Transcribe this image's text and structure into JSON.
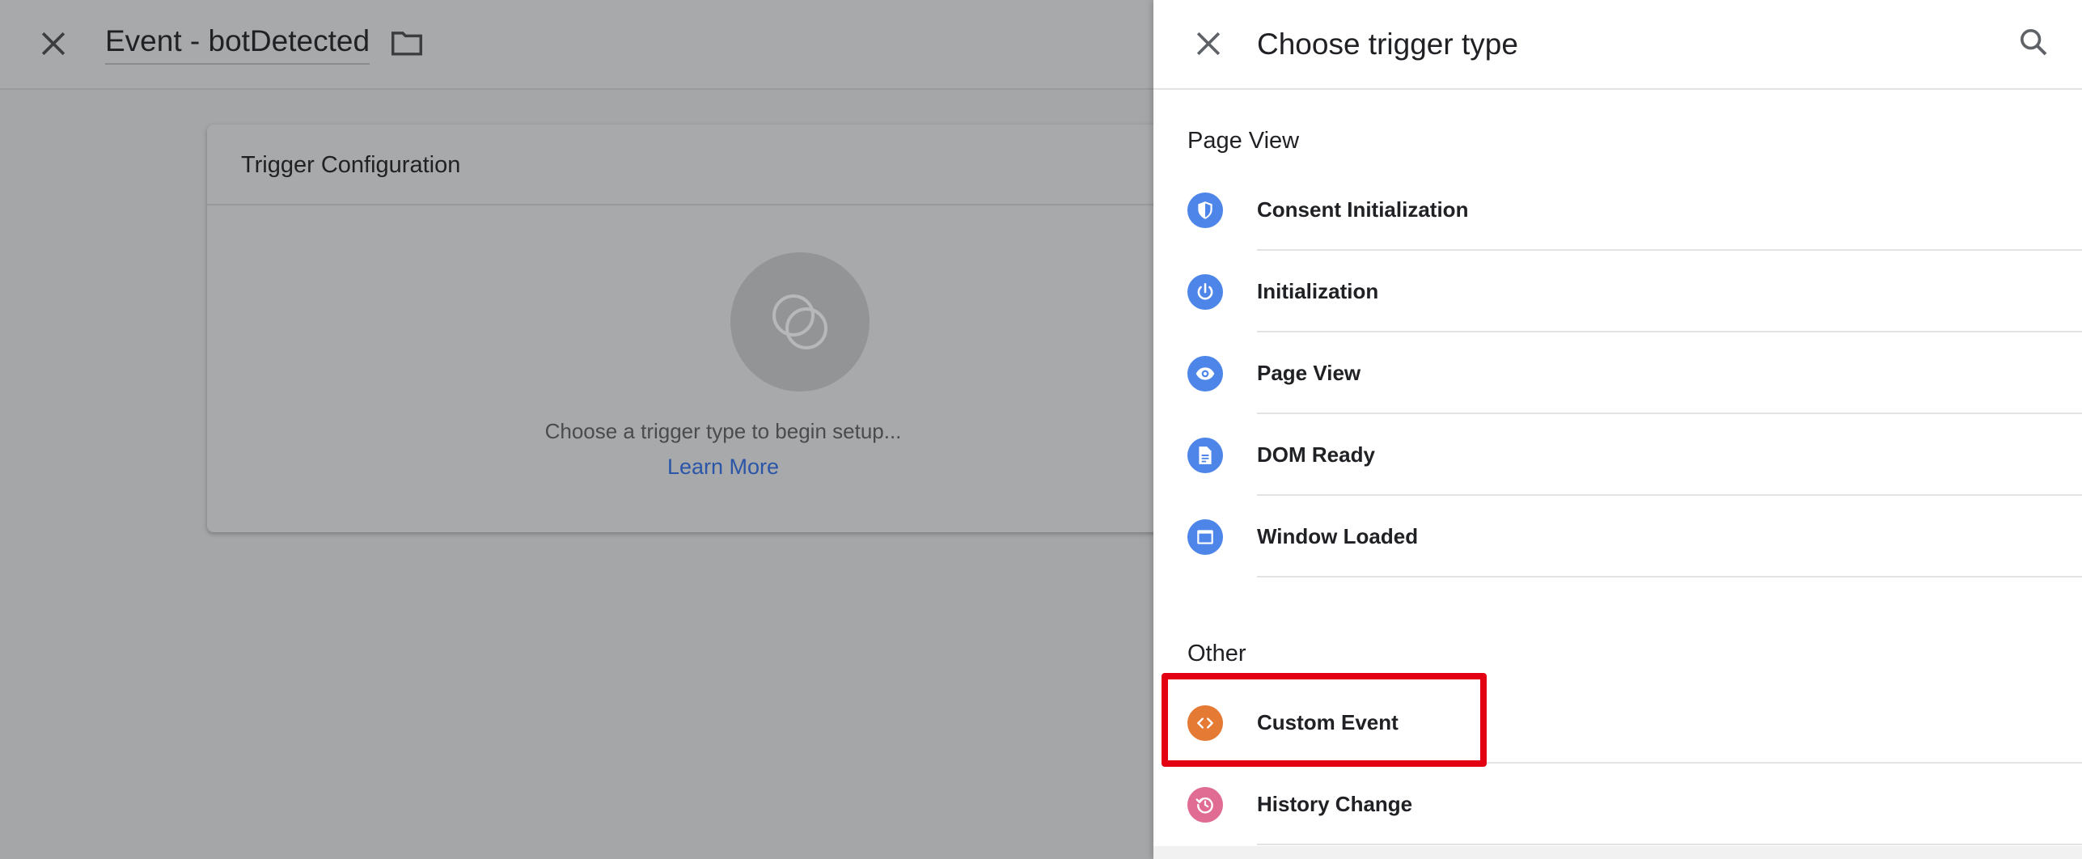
{
  "editor": {
    "title": "Event - botDetected",
    "card_title": "Trigger Configuration",
    "card_prompt": "Choose a trigger type to begin setup...",
    "learn_more": "Learn More"
  },
  "panel": {
    "title": "Choose trigger type",
    "sections": [
      {
        "label": "Page View",
        "items": [
          {
            "label": "Consent Initialization",
            "icon": "shield-icon",
            "color": "#4d86e8"
          },
          {
            "label": "Initialization",
            "icon": "power-icon",
            "color": "#4d86e8"
          },
          {
            "label": "Page View",
            "icon": "eye-icon",
            "color": "#4d86e8"
          },
          {
            "label": "DOM Ready",
            "icon": "document-icon",
            "color": "#4d86e8"
          },
          {
            "label": "Window Loaded",
            "icon": "window-icon",
            "color": "#4d86e8"
          }
        ]
      },
      {
        "label": "Other",
        "items": [
          {
            "label": "Custom Event",
            "icon": "code-icon",
            "color": "#e47a33",
            "highlighted": true
          },
          {
            "label": "History Change",
            "icon": "history-icon",
            "color": "#e06b93"
          }
        ]
      }
    ]
  },
  "colors": {
    "highlight": "#e30012",
    "accent_blue": "#4d86e8",
    "link": "#2a55a8"
  }
}
